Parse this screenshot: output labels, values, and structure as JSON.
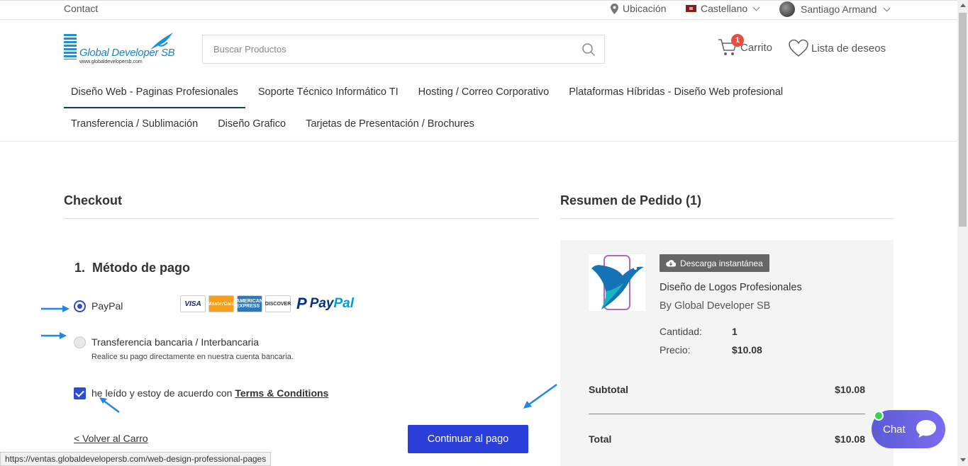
{
  "topbar": {
    "contact": "Contact",
    "location": "Ubicación",
    "language": "Castellano",
    "user": "Santiago Armand"
  },
  "header": {
    "logo_name": "Global Developer SB",
    "logo_url": "www.globaldevelopersb.com",
    "search_placeholder": "Buscar Productos",
    "cart_label": "Carrito",
    "cart_count": "1",
    "wishlist_label": "Lista de deseos"
  },
  "nav": {
    "row1": [
      "Diseño Web - Paginas Profesionales",
      "Soporte Técnico Informático TI",
      "Hosting / Correo Corporativo",
      "Plataformas Híbridas - Diseño Web profesional"
    ],
    "row2": [
      "Transferencia / Sublimación",
      "Diseño Grafico",
      "Tarjetas de Presentación / Brochures"
    ]
  },
  "checkout": {
    "title": "Checkout",
    "step_number": "1.",
    "step_title": "Método de pago",
    "options": [
      {
        "label": "PayPal",
        "selected": true
      },
      {
        "label": "Transferencia bancaria / Interbancaria",
        "description": "Realice su pago directamente en nuestra cuenta bancaria.",
        "selected": false
      }
    ],
    "card_logos": [
      "VISA",
      "MasterCard",
      "AMERICAN EXPRESS",
      "DISCOVER"
    ],
    "paypal_text_1": "Pay",
    "paypal_text_2": "Pal",
    "terms_prefix": "he leído y estoy de acuerdo con",
    "terms_link": "Terms & Conditions",
    "back_link": "<  Volver al Carro",
    "pay_button": "Continuar al pago"
  },
  "summary": {
    "title": "Resumen de Pedido (1)",
    "download_badge": "Descarga instantánea",
    "product_name": "Diseño de Logos Profesionales",
    "product_by": "By Global Developer SB",
    "quantity_label": "Cantidad:",
    "quantity_value": "1",
    "price_label": "Precio:",
    "price_value": "$10.08",
    "subtotal_label": "Subtotal",
    "subtotal_value": "$10.08",
    "total_label": "Total",
    "total_value": "$10.08"
  },
  "chat": {
    "label": "Chat"
  },
  "status_url": "https://ventas.globaldevelopersb.com/web-design-professional-pages",
  "colors": {
    "primary_button": "#2a3fd9",
    "radio_checked": "#2a4dd4",
    "annotation_arrow": "#1e88e5",
    "cart_badge": "#e74c3c",
    "chat_online": "#3ad34a"
  }
}
